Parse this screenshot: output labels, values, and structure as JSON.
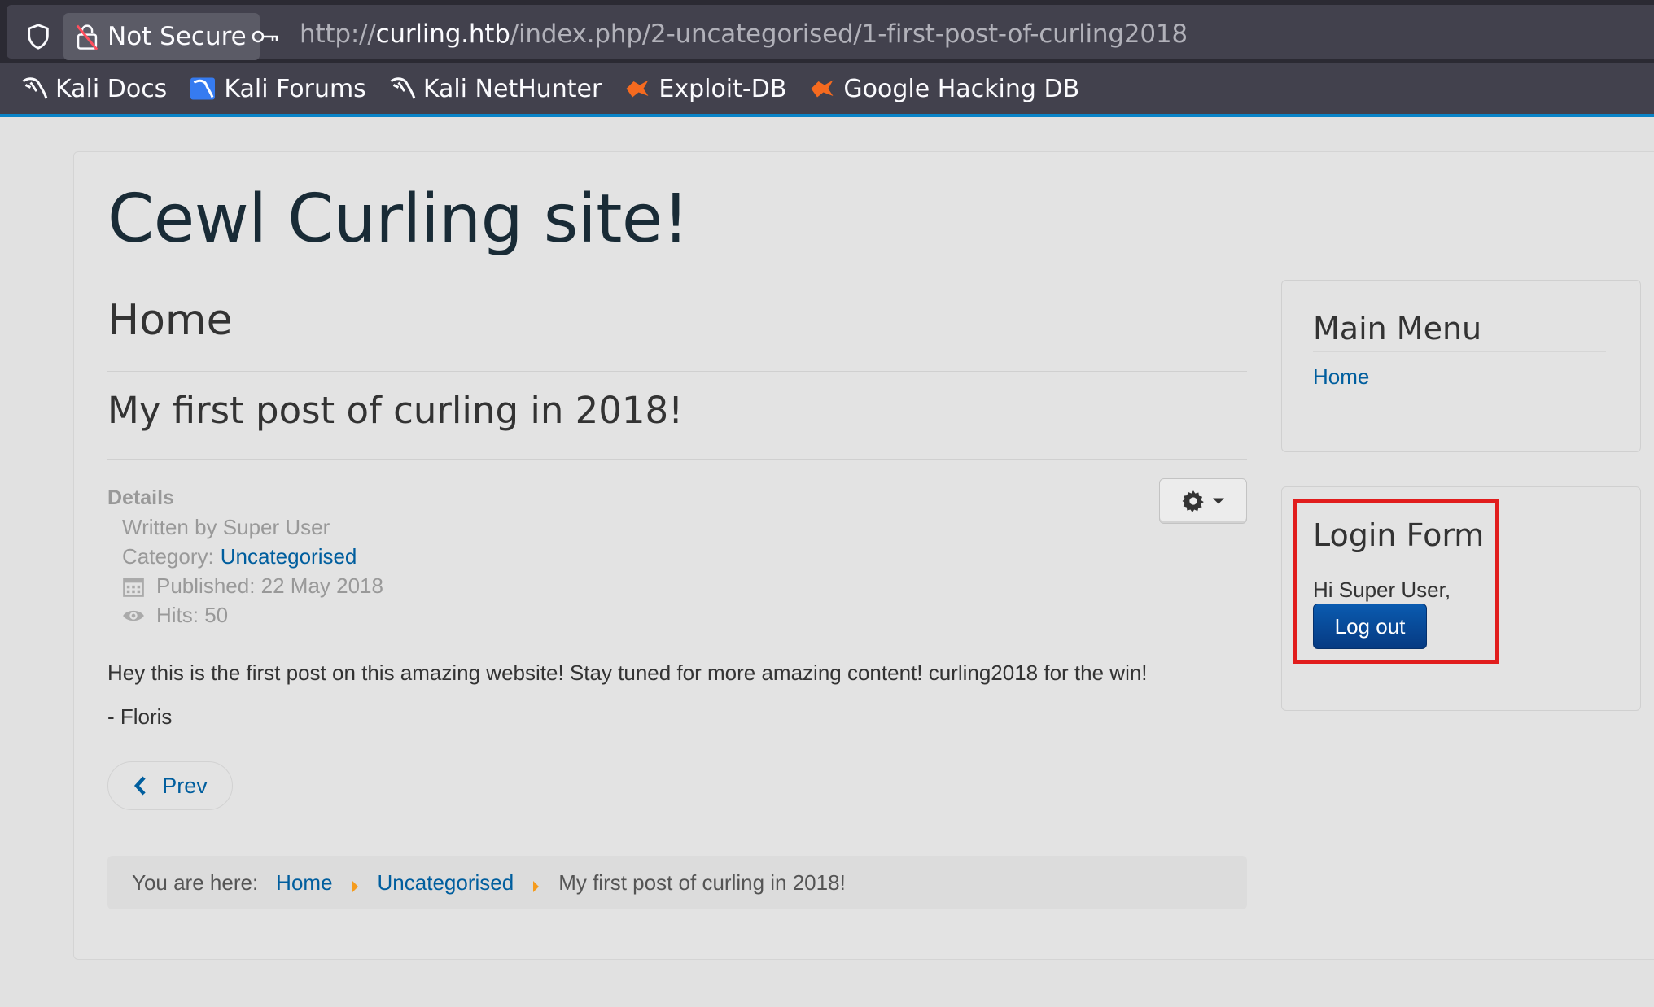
{
  "browser": {
    "security_label": "Not Secure",
    "url_scheme": "http://",
    "url_host": "curling.htb",
    "url_path": "/index.php/2-uncategorised/1-first-post-of-curling2018",
    "bookmarks": [
      {
        "label": "Kali Docs",
        "icon": "kali-dragon-icon"
      },
      {
        "label": "Kali Forums",
        "icon": "kali-forums-icon"
      },
      {
        "label": "Kali NetHunter",
        "icon": "kali-dragon-icon"
      },
      {
        "label": "Exploit-DB",
        "icon": "exploit-db-icon"
      },
      {
        "label": "Google Hacking DB",
        "icon": "exploit-db-icon"
      }
    ]
  },
  "site": {
    "title": "Cewl Curling site!",
    "page_heading": "Home"
  },
  "article": {
    "title": "My first post of curling in 2018!",
    "details_label": "Details",
    "written_by": "Written by Super User",
    "category_label": "Category:",
    "category_link": "Uncategorised",
    "published": "Published: 22 May 2018",
    "hits": "Hits: 50",
    "body": "Hey this is the first post on this amazing website! Stay tuned for more amazing content! curling2018 for the win!",
    "signature": "- Floris",
    "prev_label": "Prev"
  },
  "breadcrumb": {
    "label": "You are here:",
    "items": [
      "Home",
      "Uncategorised",
      "My first post of curling in 2018!"
    ]
  },
  "sidebar": {
    "main_menu_title": "Main Menu",
    "main_menu_items": [
      "Home"
    ],
    "login_title": "Login Form",
    "greeting": "Hi Super User,",
    "logout_label": "Log out"
  },
  "colors": {
    "link": "#005e9e",
    "highlight": "#e11d1d",
    "logout_button": "#0a5bb0",
    "breadcrumb_separator": "#f59b1d"
  }
}
